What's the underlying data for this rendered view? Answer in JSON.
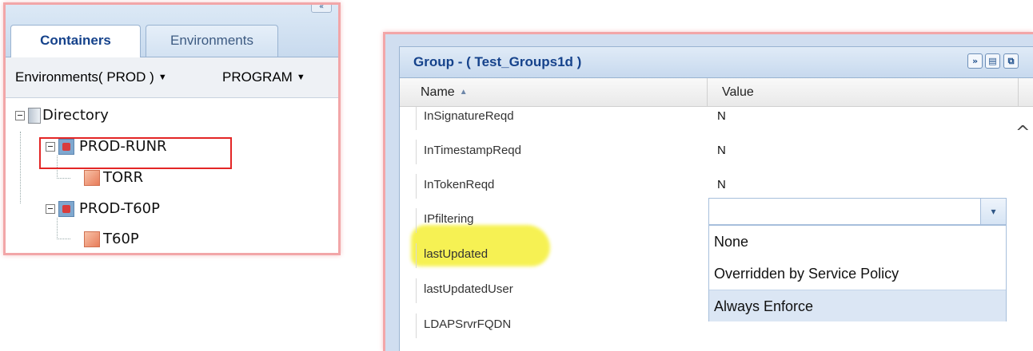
{
  "left_panel": {
    "collapse_glyph": "«",
    "tabs": [
      {
        "label": "Containers",
        "active": true
      },
      {
        "label": "Environments",
        "active": false
      }
    ],
    "env_dropdown": {
      "label": "Environments( PROD )",
      "caret": "▼"
    },
    "program_dropdown": {
      "label": "PROGRAM",
      "caret": "▼"
    },
    "tree": {
      "root": "Directory",
      "items": [
        {
          "label": "PROD-RUNR",
          "icon": "container-icon",
          "highlighted": true
        },
        {
          "label": "TORR",
          "icon": "service-icon"
        },
        {
          "label": "PROD-T60P",
          "icon": "container-icon"
        },
        {
          "label": "T60P",
          "icon": "service-icon"
        }
      ]
    }
  },
  "right_panel": {
    "title": "Group - ( Test_Groups1d )",
    "header_buttons": {
      "expand": "»",
      "save": "▤",
      "restore": "⧉"
    },
    "columns": {
      "name": "Name",
      "value": "Value",
      "sort_indicator": "▲"
    },
    "rows": [
      {
        "name": "InSignatureReqd",
        "value": "N"
      },
      {
        "name": "InTimestampReqd",
        "value": "N"
      },
      {
        "name": "InTokenReqd",
        "value": "N"
      },
      {
        "name": "IPfiltering",
        "value": ""
      },
      {
        "name": "lastUpdated",
        "value": ""
      },
      {
        "name": "lastUpdatedUser",
        "value": ""
      },
      {
        "name": "LDAPSrvrFQDN",
        "value": ""
      }
    ],
    "ipfiltering_select": {
      "value": "",
      "trigger": "▾"
    },
    "dropdown_options": [
      "None",
      "Overridden by Service Policy",
      "Always Enforce"
    ],
    "highlighted_option_index": 2,
    "scroll_up_glyph": "^",
    "colors": {
      "highlight": "#f6f14a",
      "panel_border": "#f2a6a8",
      "selection_box": "#e32626",
      "title": "#15428b"
    }
  }
}
